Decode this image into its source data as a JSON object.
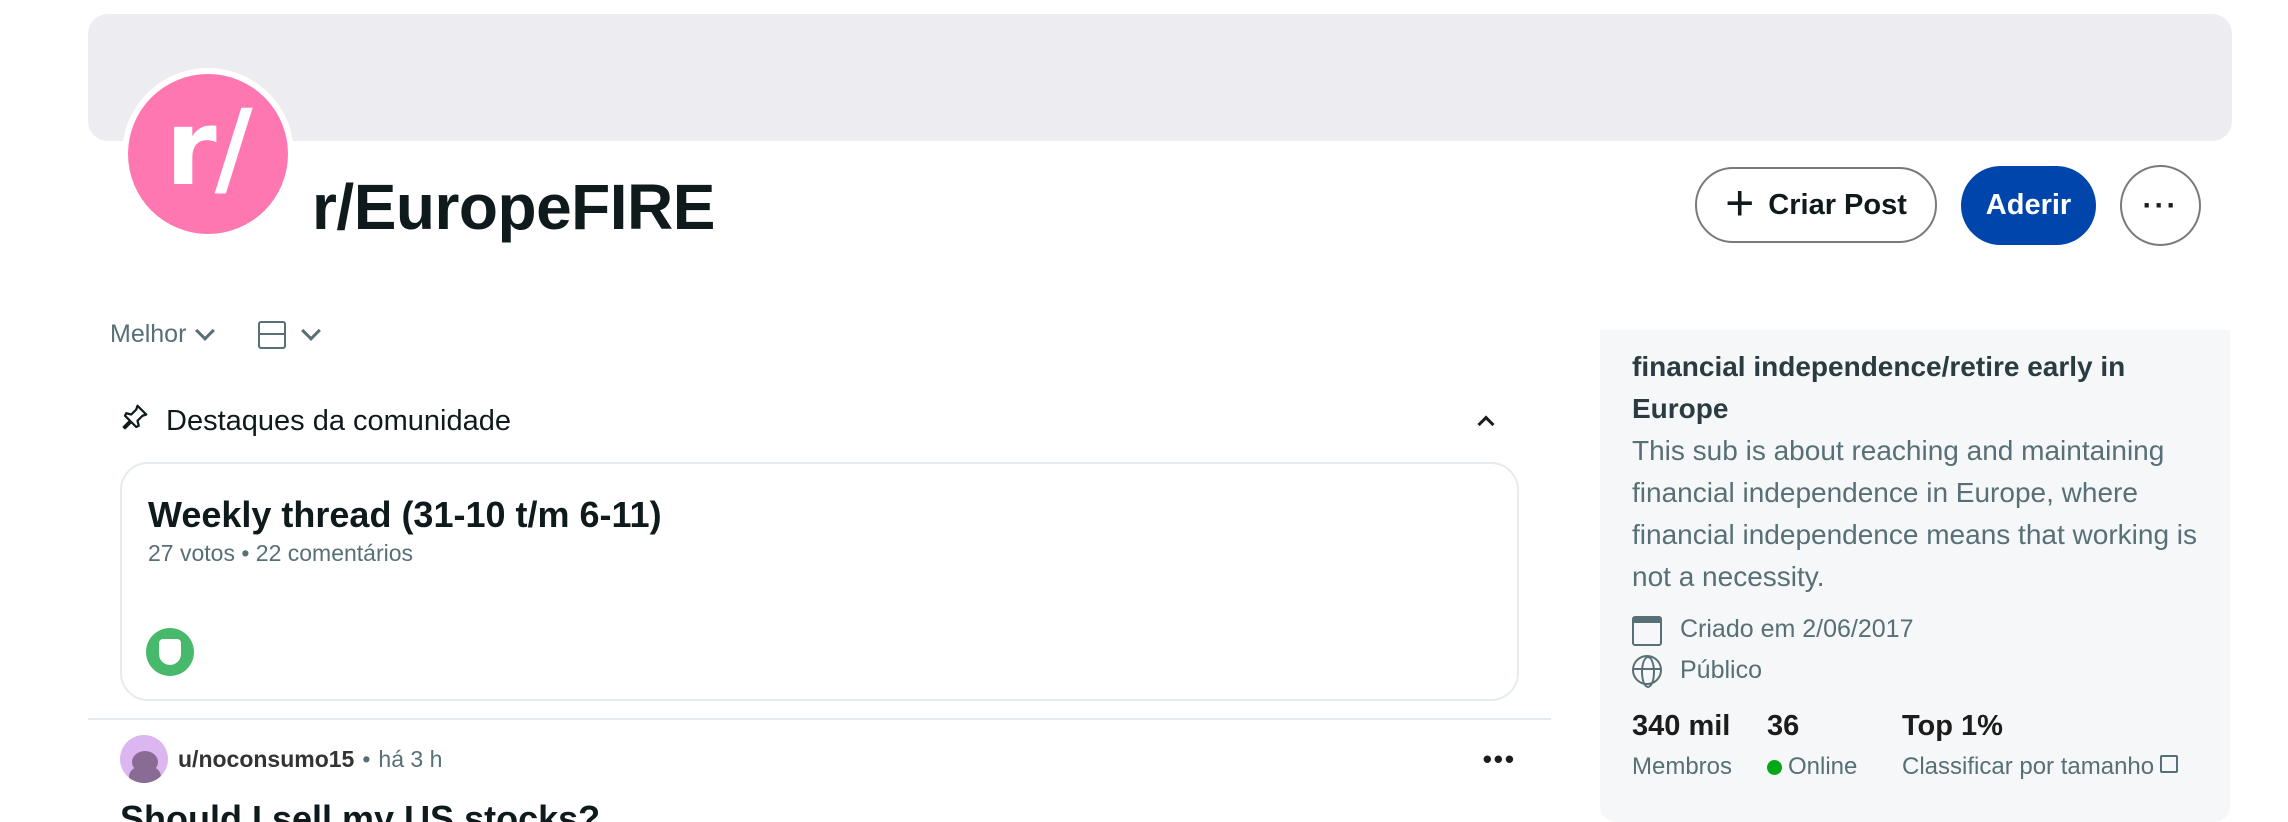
{
  "header": {
    "avatar_text": "r/",
    "subreddit_name": "r/EuropeFIRE",
    "create_post_label": "Criar Post",
    "join_label": "Aderir",
    "more_label": "···",
    "colors": {
      "avatar": "#ff77b0",
      "join_button": "#0045ac"
    }
  },
  "feed_controls": {
    "sort_label": "Melhor",
    "view_icon": "layout-card-icon"
  },
  "highlights": {
    "heading": "Destaques da comunidade",
    "card": {
      "title": "Weekly thread (31-10 t/m 6-11)",
      "meta": "27 votos • 22 comentários",
      "badge_icon": "mod-shield-icon"
    }
  },
  "post": {
    "author": "u/noconsumo15",
    "separator": "•",
    "time": "há 3 h",
    "title": "Should I sell my US stocks?",
    "more_label": "•••"
  },
  "sidebar": {
    "title": "financial independence/retire early in Europe",
    "description": "This sub is about reaching and maintaining financial independence in Europe, where financial independence means that working is not a necessity.",
    "created": "Criado em 2/06/2017",
    "visibility": "Público",
    "stats": {
      "members_value": "340 mil",
      "members_label": "Membros",
      "online_value": "36",
      "online_label": "Online",
      "rank_value": "Top 1%",
      "rank_label": "Classificar por tamanho"
    }
  }
}
